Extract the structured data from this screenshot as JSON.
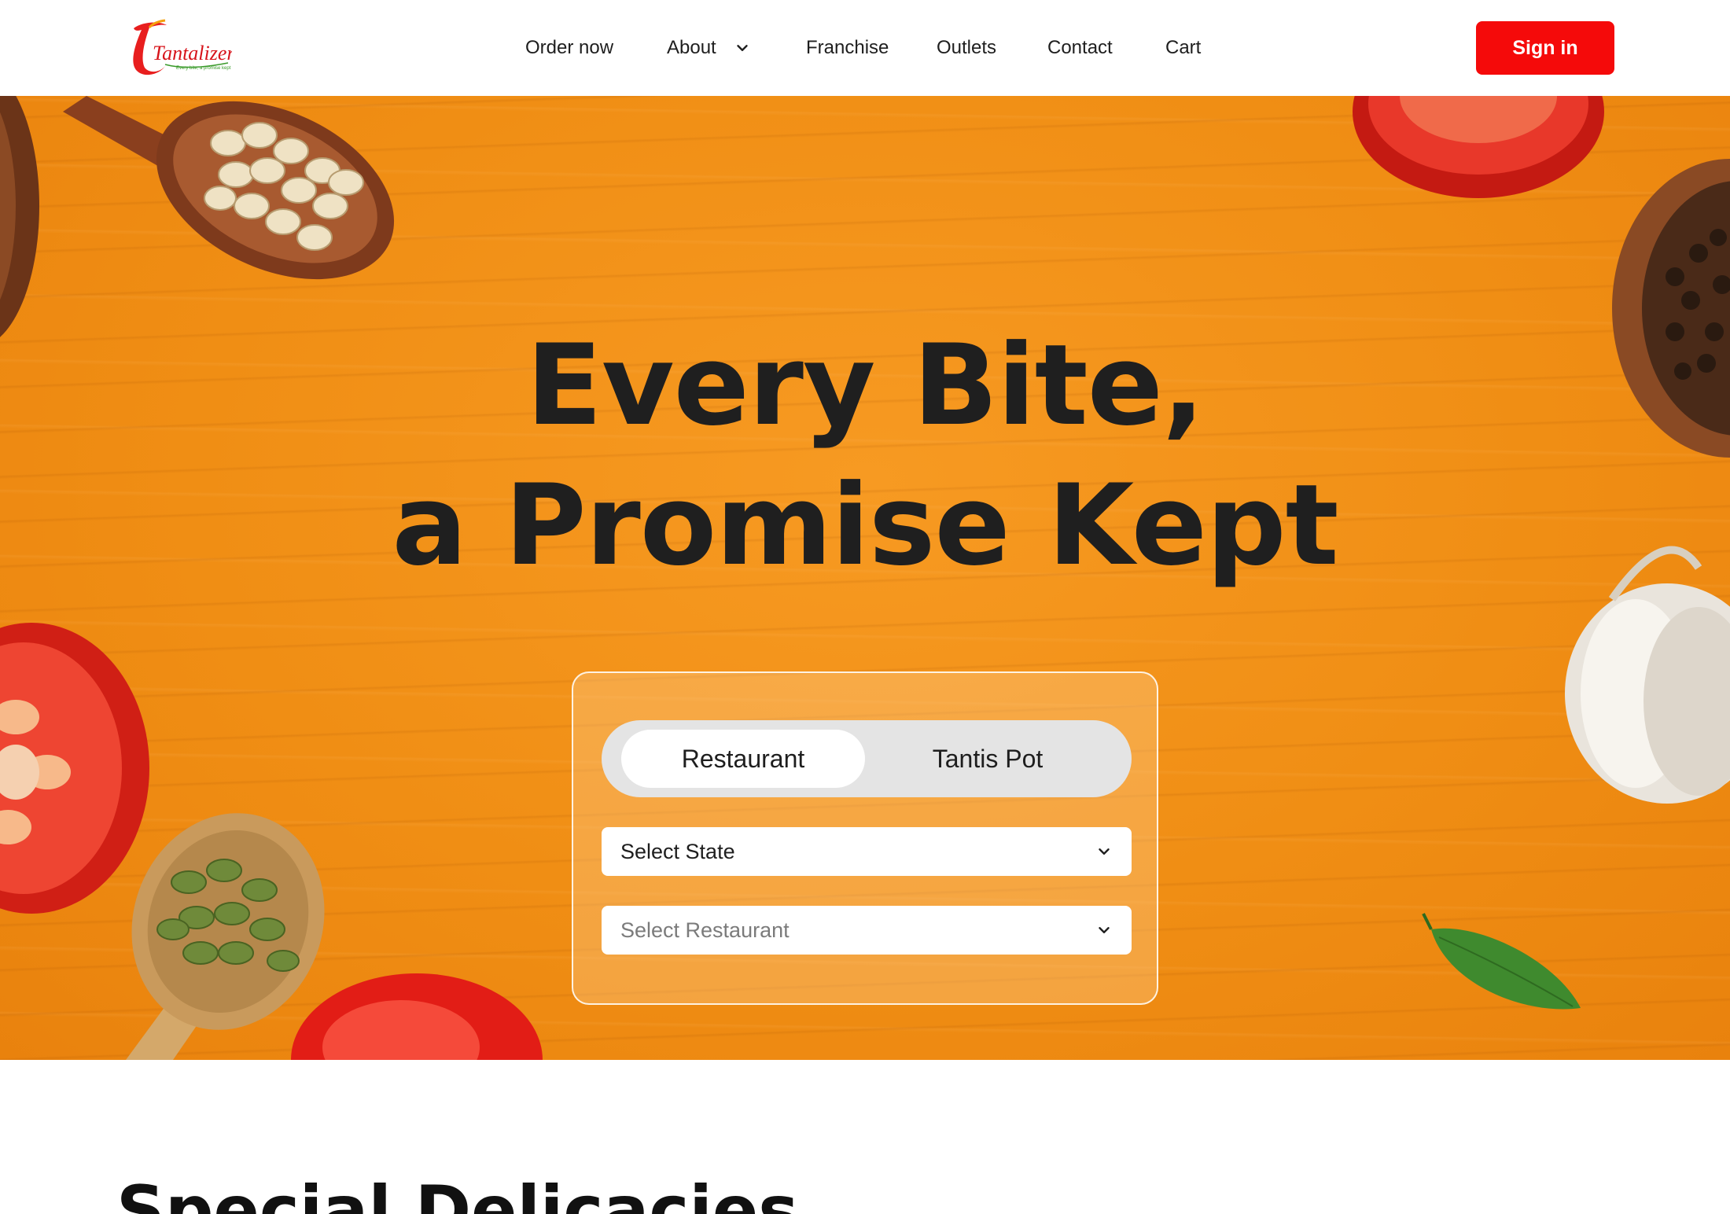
{
  "brand": {
    "logo_text": "Tantalizers",
    "logo_tagline": "Every bite, a promise kept",
    "accent_color": "#f50a0a",
    "hero_color": "#f08e14"
  },
  "nav": {
    "order_now": "Order now",
    "about": "About",
    "franchise": "Franchise",
    "outlets": "Outlets",
    "contact": "Contact",
    "cart": "Cart",
    "sign_in": "Sign in"
  },
  "hero": {
    "title_line1": "Every Bite,",
    "title_line2": "a Promise Kept"
  },
  "search": {
    "tabs": [
      {
        "label": "Restaurant",
        "active": true
      },
      {
        "label": "Tantis Pot",
        "active": false
      }
    ],
    "state_select": "Select State",
    "restaurant_select": "Select Restaurant"
  },
  "section": {
    "title": "Special Delicacies"
  }
}
